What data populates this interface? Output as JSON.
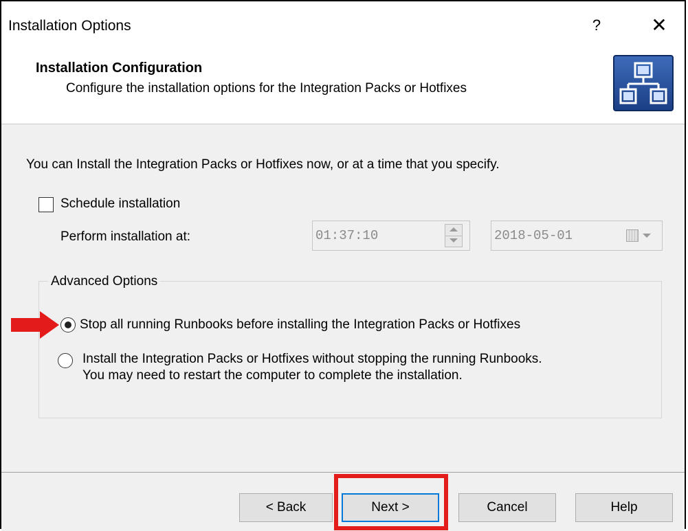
{
  "window": {
    "title": "Installation Options",
    "help_glyph": "?",
    "close_glyph": "✕"
  },
  "header": {
    "title": "Installation Configuration",
    "subtitle": "Configure the installation options for the Integration Packs or Hotfixes",
    "icon": "network-diagram-icon"
  },
  "body": {
    "intro": "You can Install the Integration Packs or Hotfixes now, or at a time that you specify.",
    "schedule_checkbox": {
      "label": "Schedule installation",
      "checked": false
    },
    "perform_label": "Perform installation at:",
    "time_value": "01:37:10",
    "date_value": "2018-05-01",
    "advanced": {
      "label": "Advanced Options",
      "options": [
        {
          "label": "Stop all running Runbooks before installing the Integration Packs or Hotfixes",
          "selected": true
        },
        {
          "label_line1": "Install the Integration Packs or Hotfixes without stopping the running Runbooks.",
          "label_line2": "You may need to restart the computer to complete the installation.",
          "selected": false
        }
      ]
    }
  },
  "footer": {
    "back_label": "< Back",
    "next_label": "Next >",
    "cancel_label": "Cancel",
    "help_label": "Help"
  },
  "annotations": {
    "color": "#e31b1b"
  }
}
